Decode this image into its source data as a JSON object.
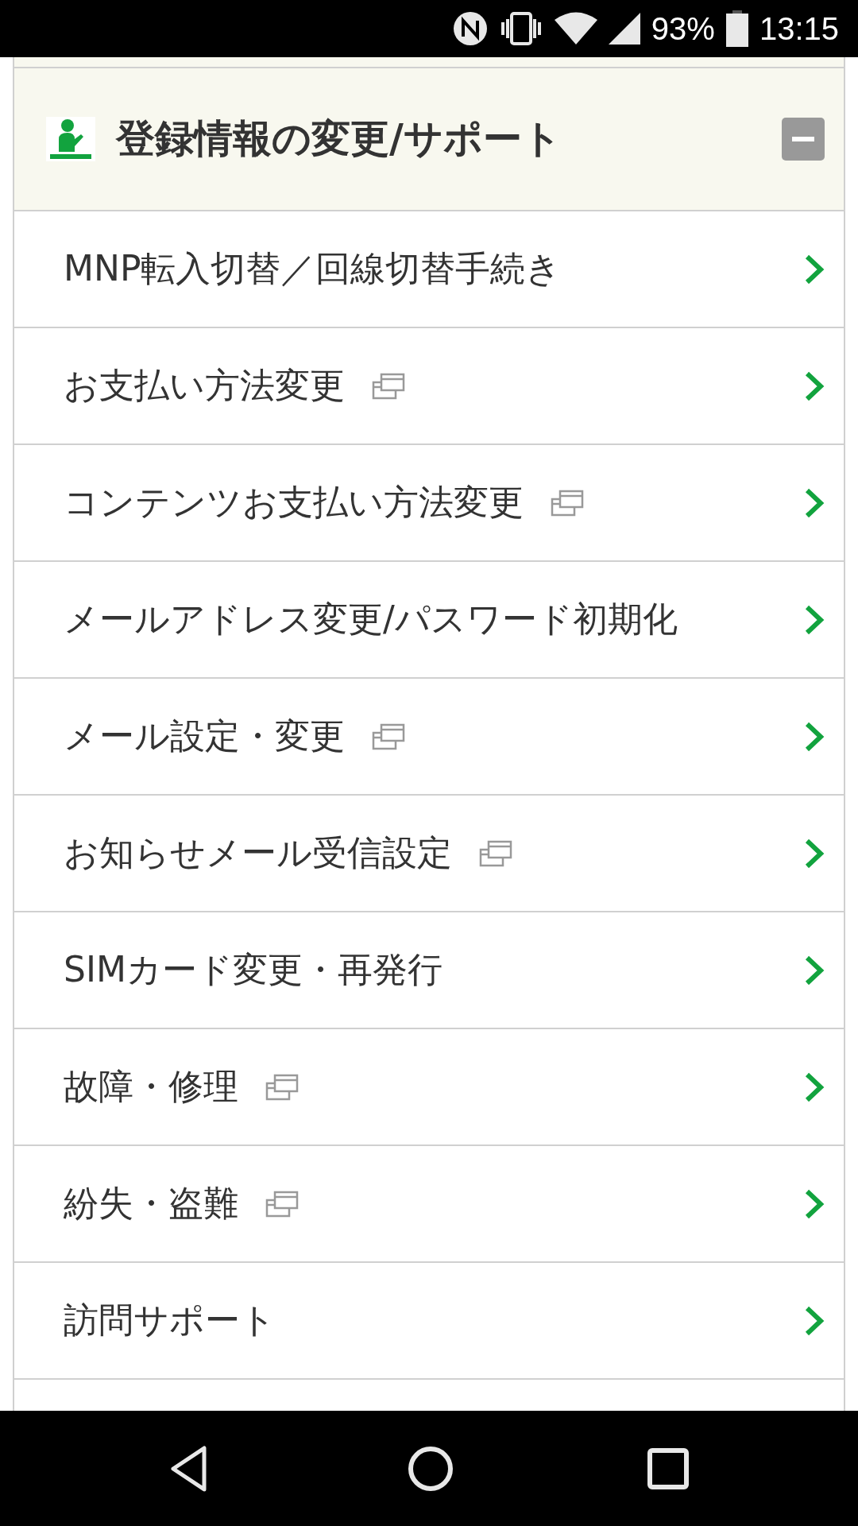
{
  "status_bar": {
    "battery": "93%",
    "time": "13:15"
  },
  "section": {
    "title": "登録情報の変更/サポート",
    "expanded": true
  },
  "items": [
    {
      "label": "MNP転入切替／回線切替手続き",
      "external": false
    },
    {
      "label": "お支払い方法変更",
      "external": true
    },
    {
      "label": "コンテンツお支払い方法変更",
      "external": true
    },
    {
      "label": "メールアドレス変更/パスワード初期化",
      "external": false
    },
    {
      "label": "メール設定・変更",
      "external": true
    },
    {
      "label": "お知らせメール受信設定",
      "external": true
    },
    {
      "label": "SIMカード変更・再発行",
      "external": false
    },
    {
      "label": "故障・修理",
      "external": true
    },
    {
      "label": "紛失・盗難",
      "external": true
    },
    {
      "label": "訪問サポート",
      "external": false
    }
  ]
}
